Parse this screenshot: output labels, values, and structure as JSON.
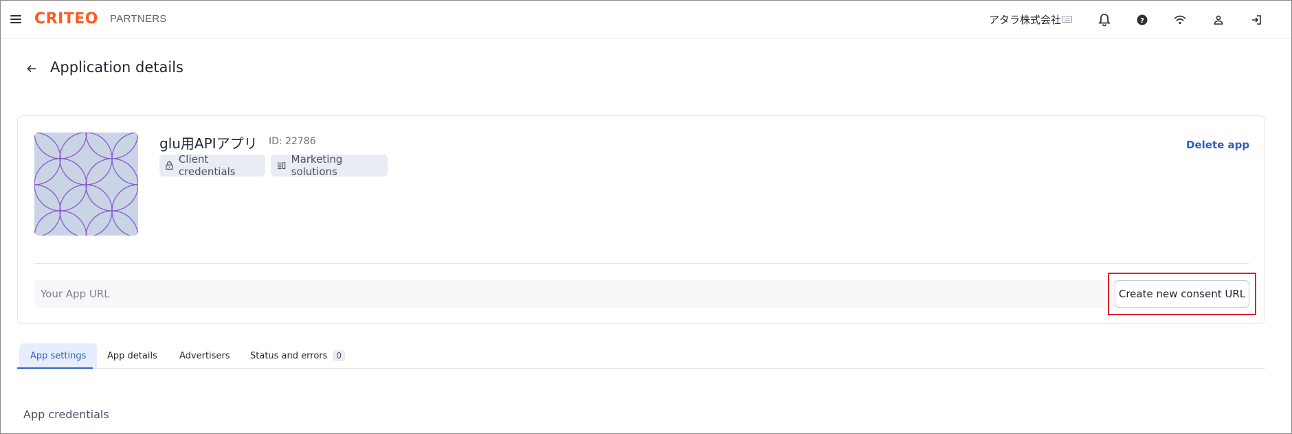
{
  "topbar": {
    "brand": "CRITEO",
    "product": "PARTNERS",
    "account_name": "アタラ株式会社"
  },
  "page": {
    "title": "Application details"
  },
  "app": {
    "name": "glu用APIアプリ",
    "id_label": "ID: 22786",
    "chips": [
      "Client credentials",
      "Marketing solutions"
    ],
    "delete_label": "Delete app",
    "url_placeholder": "Your App URL",
    "consent_button_label": "Create new consent URL"
  },
  "tabs": [
    {
      "label": "App settings",
      "active": true
    },
    {
      "label": "App details"
    },
    {
      "label": "Advertisers"
    },
    {
      "label": "Status and errors",
      "count": "0"
    }
  ],
  "section": {
    "title": "App credentials"
  },
  "colors": {
    "brand": "#ff5a1f",
    "accent": "#2f5ec4",
    "highlight": "#e0202a",
    "thumbnail_bg": "#c9d4e5",
    "thumbnail_pattern": "#8a5cd0"
  },
  "icons": [
    "menu-icon",
    "account-icon",
    "bell-icon",
    "help-icon",
    "wifi-icon",
    "user-icon",
    "logout-icon",
    "back-arrow-icon",
    "lock-icon",
    "columns-icon"
  ]
}
